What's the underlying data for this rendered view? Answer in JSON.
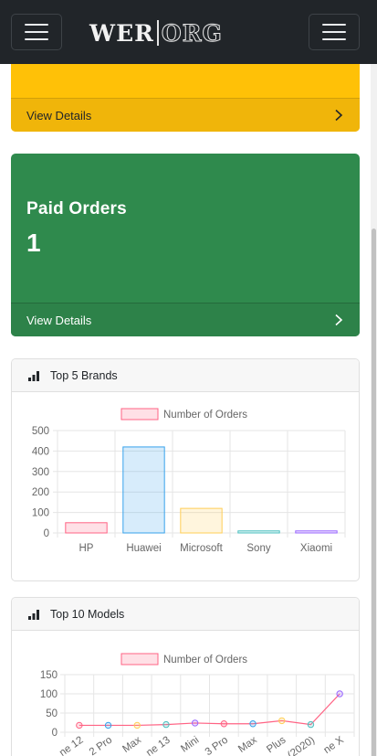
{
  "navbar": {
    "brand_left": "WER",
    "brand_right": "ORG",
    "left_toggle_icon": "hamburger-menu-icon",
    "right_toggle_icon": "hamburger-menu-icon"
  },
  "cards": {
    "warning": {
      "footer_label": "View Details",
      "footer_icon": "chevron-right-icon",
      "color": "#ffc107"
    },
    "paid": {
      "title": "Paid Orders",
      "value": "1",
      "footer_label": "View Details",
      "footer_icon": "chevron-right-icon",
      "color": "#2f8a4d"
    }
  },
  "brands_card": {
    "title": "Top 5 Brands",
    "icon": "bar-chart-icon"
  },
  "models_card": {
    "title": "Top 10 Models",
    "icon": "bar-chart-icon"
  },
  "chart_data": [
    {
      "type": "bar",
      "legend": "Number of Orders",
      "categories": [
        "HP",
        "Huawei",
        "Microsoft",
        "Sony",
        "Xiaomi"
      ],
      "values": [
        50,
        420,
        120,
        10,
        10
      ],
      "colors": [
        "#ff6384",
        "#36a2eb",
        "#ffce56",
        "#4bc0c0",
        "#9966ff"
      ],
      "ylim": [
        0,
        500
      ],
      "yticks": [
        0,
        100,
        200,
        300,
        400,
        500
      ],
      "grid": true,
      "legend_position": "top"
    },
    {
      "type": "line",
      "legend": "Number of Orders",
      "categories": [
        "ne 12",
        "2 Pro",
        "Max",
        "ne 13",
        "Mini",
        "3 Pro",
        "Max",
        "Plus",
        "(2020)",
        "ne X"
      ],
      "values": [
        18,
        18,
        18,
        20,
        24,
        22,
        22,
        30,
        20,
        100
      ],
      "point_colors": [
        "#ff6384",
        "#36a2eb",
        "#ffce56",
        "#4bc0c0",
        "#9966ff",
        "#ff6384",
        "#36a2eb",
        "#ffce56",
        "#4bc0c0",
        "#9966ff"
      ],
      "line_color": "#ff6384",
      "ylim": [
        0,
        150
      ],
      "yticks": [
        0,
        50,
        100,
        150
      ],
      "grid": true,
      "legend_position": "top"
    }
  ]
}
